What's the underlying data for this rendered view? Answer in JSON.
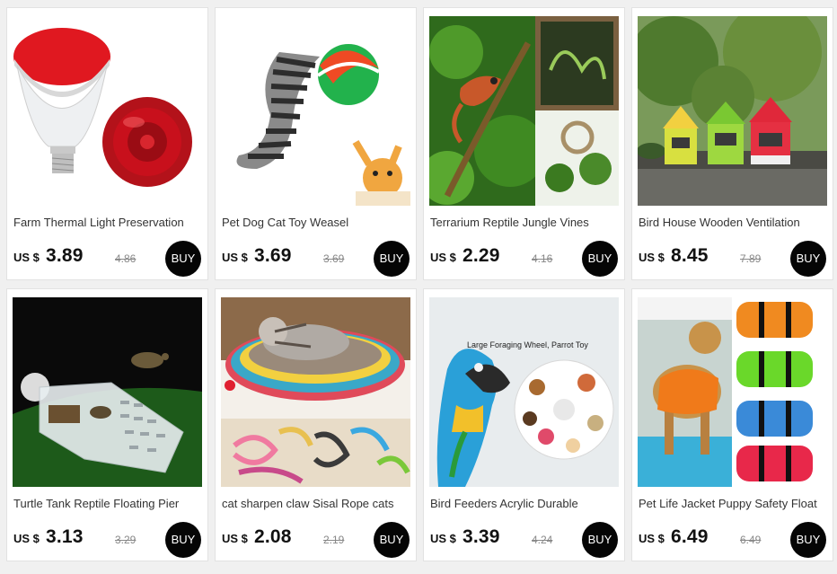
{
  "currency_label": "US $",
  "buy_label": "BUY",
  "products": [
    {
      "title": "Farm Thermal Light Preservation",
      "price": "3.89",
      "old_price": "4.86",
      "image": "red-heat-lamp-bulb"
    },
    {
      "title": "Pet Dog Cat Toy Weasel",
      "price": "3.69",
      "old_price": "3.69",
      "image": "weasel-ball-toy-with-kitten"
    },
    {
      "title": "Terrarium Reptile Jungle Vines",
      "price": "2.29",
      "old_price": "4.16",
      "image": "chameleon-on-jungle-vines"
    },
    {
      "title": "Bird House Wooden Ventilation",
      "price": "8.45",
      "old_price": "7.89",
      "image": "colorful-wooden-bird-houses"
    },
    {
      "title": "Turtle Tank Reptile Floating Pier",
      "price": "3.13",
      "old_price": "3.29",
      "image": "acrylic-turtle-floating-pier"
    },
    {
      "title": "cat sharpen claw Sisal Rope cats",
      "price": "2.08",
      "old_price": "2.19",
      "image": "cat-in-rope-basket"
    },
    {
      "title": "Bird Feeders Acrylic Durable",
      "price": "3.39",
      "old_price": "4.24",
      "image": "parrot-with-foraging-wheel",
      "image_caption": "Large Foraging Wheel, Parrot Toy"
    },
    {
      "title": "Pet Life Jacket Puppy Safety Float",
      "price": "6.49",
      "old_price": "6.49",
      "image": "dog-life-jackets"
    }
  ]
}
